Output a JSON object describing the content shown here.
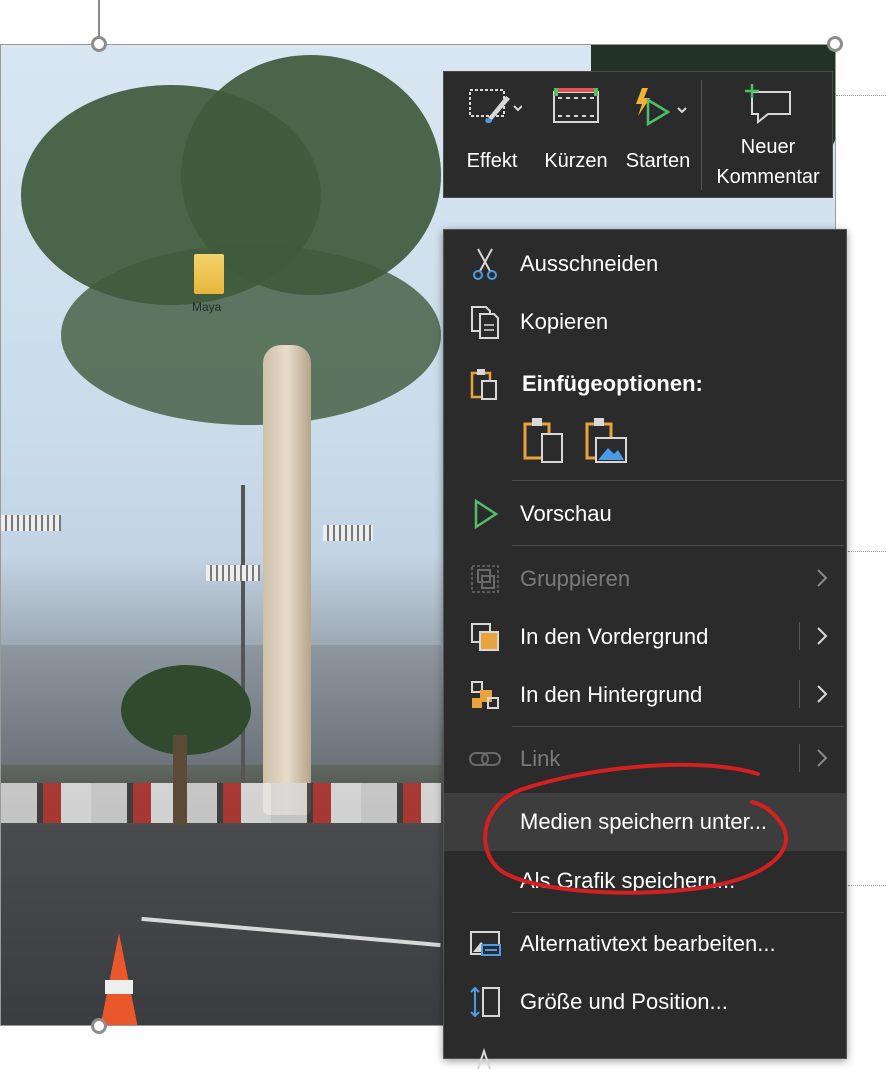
{
  "desktop_icon": {
    "label": "Maya"
  },
  "mini_toolbar": {
    "items": [
      {
        "label": "Effekt",
        "icon": "effect-icon"
      },
      {
        "label": "Kürzen",
        "icon": "trim-icon"
      },
      {
        "label": "Starten",
        "icon": "start-icon"
      },
      {
        "label_line1": "Neuer",
        "label_line2": "Kommentar",
        "icon": "new-comment-icon"
      }
    ]
  },
  "context_menu": {
    "items": [
      {
        "label": "Ausschneiden",
        "icon": "scissors-icon",
        "enabled": true
      },
      {
        "label": "Kopieren",
        "icon": "copy-icon",
        "enabled": true
      },
      {
        "label": "Einfügeoptionen:",
        "icon": "paste-icon",
        "enabled": true,
        "header": true
      },
      {
        "label": "Vorschau",
        "icon": "play-icon",
        "enabled": true
      },
      {
        "label": "Gruppieren",
        "icon": "group-icon",
        "enabled": false,
        "submenu": true
      },
      {
        "label": "In den Vordergrund",
        "icon": "bring-forward-icon",
        "enabled": true,
        "submenu": true
      },
      {
        "label": "In den Hintergrund",
        "icon": "send-backward-icon",
        "enabled": true,
        "submenu": true
      },
      {
        "label": "Link",
        "icon": "link-icon",
        "enabled": false,
        "submenu": true
      },
      {
        "label": "Medien speichern unter...",
        "icon": "",
        "enabled": true,
        "highlighted": true
      },
      {
        "label": "Als Grafik speichern...",
        "icon": "",
        "enabled": true
      },
      {
        "label": "Alternativtext bearbeiten...",
        "icon": "alt-text-icon",
        "enabled": true
      },
      {
        "label": "Größe und Position...",
        "icon": "size-position-icon",
        "enabled": true
      }
    ],
    "paste_options": [
      "paste-keep-source-icon",
      "paste-as-picture-icon"
    ]
  },
  "colors": {
    "menu_bg": "#2b2b2b",
    "accent_orange": "#e8a33d",
    "accent_green": "#4fc06a",
    "annotation_red": "#d42020"
  }
}
